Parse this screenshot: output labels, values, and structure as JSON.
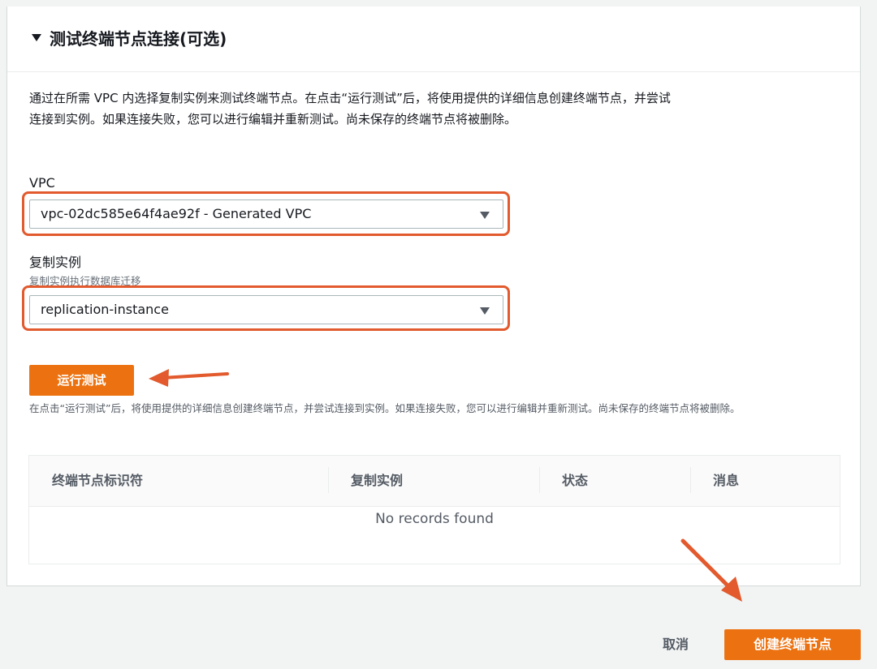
{
  "section": {
    "title": "测试终端节点连接(可选)",
    "description": "通过在所需 VPC 内选择复制实例来测试终端节点。在点击“运行测试”后，将使用提供的详细信息创建终端节点，并尝试连接到实例。如果连接失败，您可以进行编辑并重新测试。尚未保存的终端节点将被删除。"
  },
  "vpc": {
    "label": "VPC",
    "value": "vpc-02dc585e64f4ae92f - Generated VPC"
  },
  "replication": {
    "label": "复制实例",
    "hint": "复制实例执行数据库迁移",
    "value": "replication-instance"
  },
  "run_test": {
    "label": "运行测试",
    "note": "在点击“运行测试”后，将使用提供的详细信息创建终端节点，并尝试连接到实例。如果连接失败，您可以进行编辑并重新测试。尚未保存的终端节点将被删除。"
  },
  "table": {
    "columns": [
      "终端节点标识符",
      "复制实例",
      "状态",
      "消息"
    ],
    "empty_text": "No records found"
  },
  "footer": {
    "cancel_label": "取消",
    "create_label": "创建终端节点"
  },
  "colors": {
    "primary": "#ec7211",
    "annotation": "#e25a2d"
  }
}
